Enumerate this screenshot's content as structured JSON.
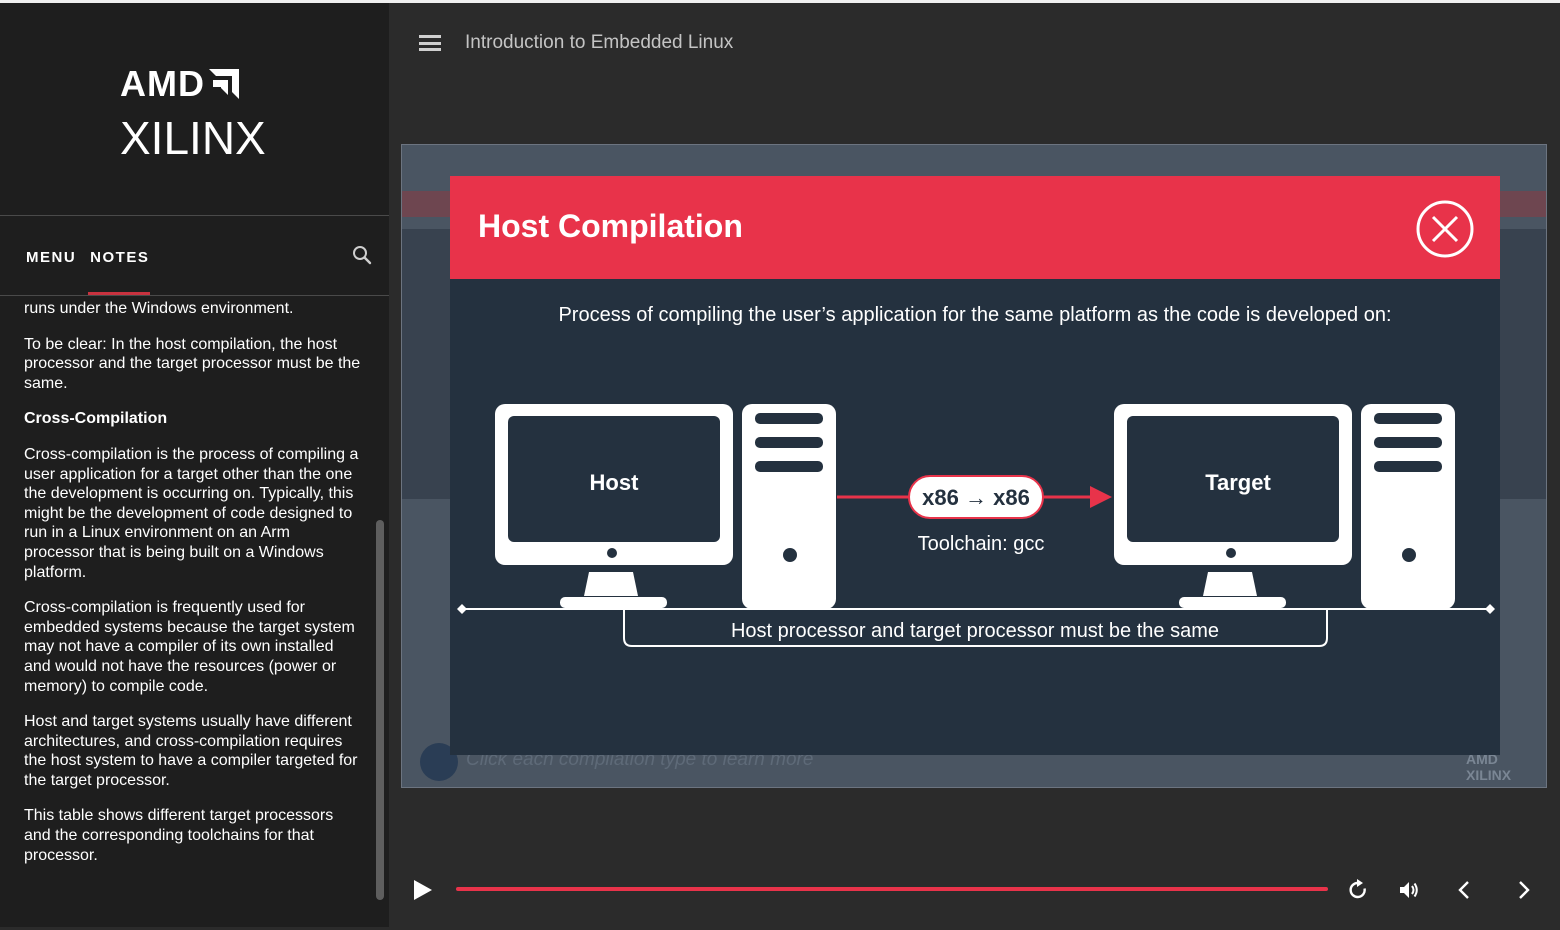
{
  "brand": {
    "line1": "AMD",
    "line2": "XILINX"
  },
  "sidebar": {
    "tabs": [
      {
        "label": "MENU"
      },
      {
        "label": "NOTES"
      }
    ],
    "notes": [
      {
        "text": "runs under the Windows environment.",
        "bold": false
      },
      {
        "text": "To be clear: In the host compilation, the host processor and the target processor must be the same.",
        "bold": false
      },
      {
        "text": "Cross-Compilation",
        "bold": true
      },
      {
        "text": "Cross-compilation is the process of compiling a user application for a target other than the one the development is occurring on. Typically, this might be the development of code designed to run in a Linux environment on an Arm processor that is being built on a Windows platform.",
        "bold": false
      },
      {
        "text": "Cross-compilation is frequently used for embedded systems because the target system may not have a compiler of its own installed and would not have the resources (power or memory) to compile code.",
        "bold": false
      },
      {
        "text": "Host and target systems usually have different architectures, and cross-compilation requires the host system to have a compiler targeted for the target processor.",
        "bold": false
      },
      {
        "text": "This table shows different target processors and the corresponding toolchains for that processor.",
        "bold": false
      }
    ]
  },
  "header": {
    "title": "Introduction to Embedded Linux"
  },
  "slide": {
    "background_hint": "Click each compilation type to learn more",
    "background_logo": {
      "line1": "AMD",
      "line2": "XILINX"
    },
    "modal": {
      "title": "Host Compilation",
      "subtitle": "Process of compiling the user’s application for the same platform as the code is developed on:",
      "host_label": "Host",
      "target_label": "Target",
      "arch_label": "x86 → x86",
      "toolchain_label": "Toolchain: gcc",
      "bracket_label": "Host processor and target processor must be the same"
    }
  },
  "colors": {
    "accent": "#e8334a",
    "modal_bg": "#24313f",
    "sidebar_bg": "#1e1e1e"
  },
  "icons": [
    "hamburger-icon",
    "search-icon",
    "close-icon",
    "play-icon",
    "replay-icon",
    "volume-icon",
    "chevron-left-icon",
    "chevron-right-icon",
    "info-icon"
  ]
}
